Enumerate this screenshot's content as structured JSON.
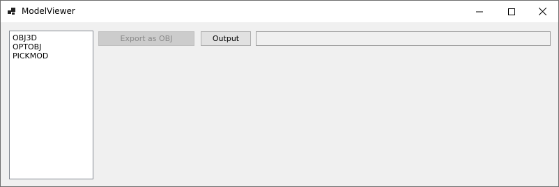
{
  "window": {
    "title": "ModelViewer"
  },
  "controls": {
    "minimize_icon": "minimize-icon",
    "maximize_icon": "maximize-icon",
    "close_icon": "close-icon"
  },
  "list": {
    "items": [
      {
        "label": "OBJ3D"
      },
      {
        "label": "OPTOBJ"
      },
      {
        "label": "PICKMOD"
      }
    ]
  },
  "toolbar": {
    "export_label": "Export as OBJ",
    "output_label": "Output",
    "output_path": ""
  }
}
